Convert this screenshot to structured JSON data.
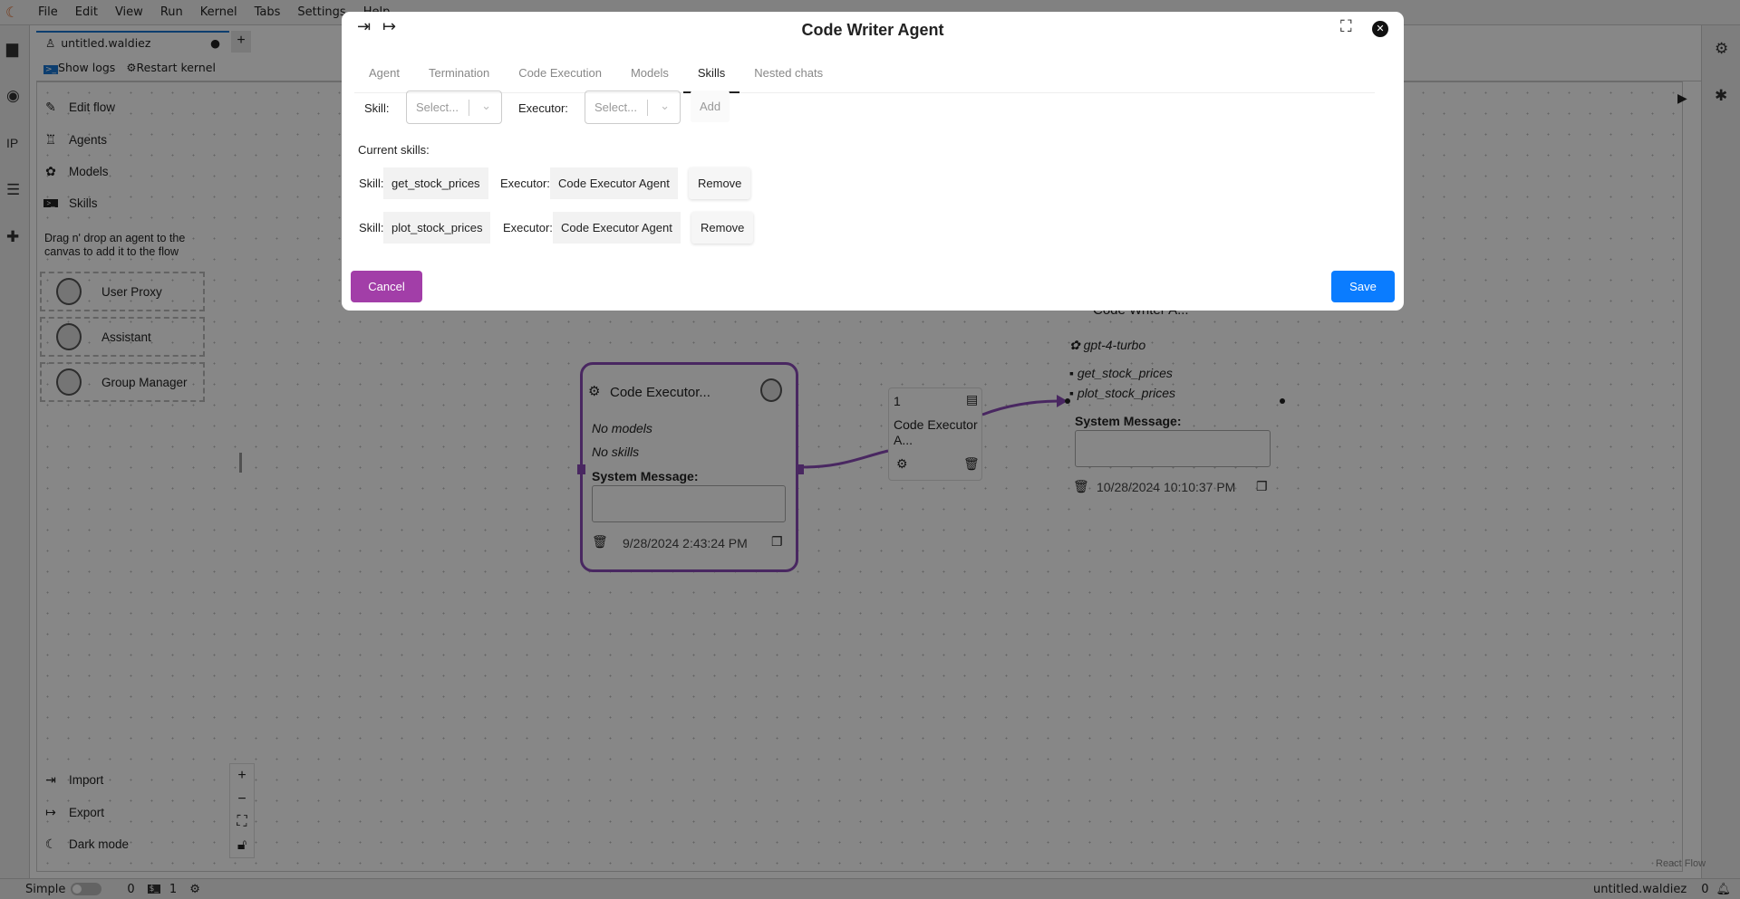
{
  "menu": [
    "File",
    "Edit",
    "View",
    "Run",
    "Kernel",
    "Tabs",
    "Settings",
    "Help"
  ],
  "tab": {
    "title": "untitled.waldiez",
    "new": "+"
  },
  "toolbar": {
    "show_logs": "Show logs",
    "restart": "Restart kernel"
  },
  "sidebar": {
    "items": [
      "Edit flow",
      "Agents",
      "Models",
      "Skills"
    ],
    "hint": "Drag n' drop an agent to the canvas to add it to the flow",
    "agents": [
      "User Proxy",
      "Assistant",
      "Group Manager"
    ],
    "bottom": [
      "Import",
      "Export",
      "Dark mode"
    ]
  },
  "nodes": {
    "executor": {
      "title": "Code Executor...",
      "models": "No models",
      "skills": "No skills",
      "sysmsg": "System Message:",
      "date": "9/28/2024 2:43:24 PM"
    },
    "edge": {
      "order": "1",
      "label": "Code Executor A..."
    },
    "writer": {
      "title": "Code Writer A...",
      "model": "gpt-4-turbo",
      "skills": [
        "get_stock_prices",
        "plot_stock_prices"
      ],
      "sysmsg": "System Message:",
      "date": "10/28/2024 10:10:37 PM"
    }
  },
  "react_flow": "React Flow",
  "status": {
    "mode": "Simple",
    "count1": "0",
    "count2": "1",
    "filename": "untitled.waldiez",
    "notifications": "0"
  },
  "modal": {
    "title": "Code Writer Agent",
    "tabs": [
      "Agent",
      "Termination",
      "Code Execution",
      "Models",
      "Skills",
      "Nested chats"
    ],
    "active_tab": "Skills",
    "skill_label": "Skill:",
    "executor_label": "Executor:",
    "skill_placeholder": "Select...",
    "executor_placeholder": "Select...",
    "add": "Add",
    "current": "Current skills:",
    "rows": [
      {
        "skill": "get_stock_prices",
        "executor": "Code Executor Agent",
        "remove": "Remove"
      },
      {
        "skill": "plot_stock_prices",
        "executor": "Code Executor Agent",
        "remove": "Remove"
      }
    ],
    "cancel": "Cancel",
    "save": "Save"
  },
  "colors": {
    "cancel": "#a23ea8",
    "save": "#0a7cff",
    "edge": "#8a4bb8"
  }
}
